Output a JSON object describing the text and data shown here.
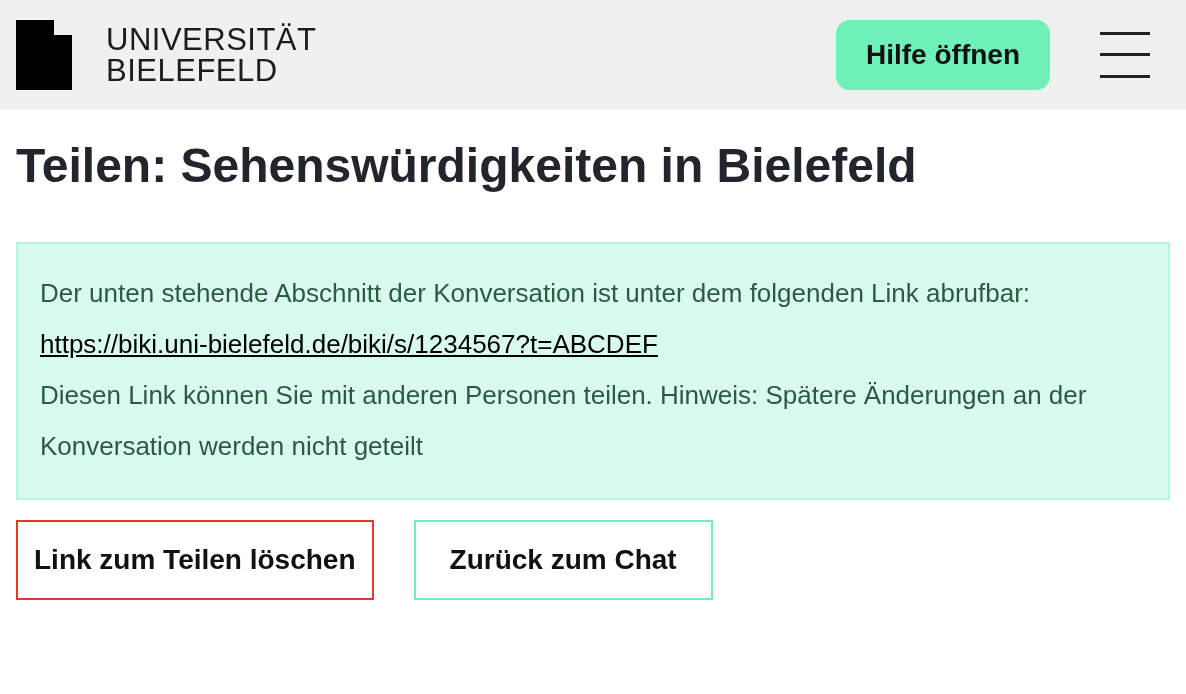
{
  "header": {
    "logo": {
      "line_1": "UNIVERSITÄT",
      "line_2": "BIELEFELD"
    },
    "help_button": "Hilfe öffnen"
  },
  "title": "Teilen: Sehenswürdigkeiten in Bielefeld",
  "info_box": {
    "intro": "Der unten stehende Abschnitt der Konversation ist unter dem folgenden Link abrufbar:",
    "link": "https://biki.uni-bielefeld.de/biki/s/1234567?t=ABCDEF",
    "note": "Diesen Link können Sie mit anderen Personen teilen. Hinweis: Spätere Änderungen an der Konversation werden nicht geteilt"
  },
  "buttons": [
    {
      "label": "Link zum Teilen löschen",
      "kind": "danger"
    },
    {
      "label": "Zurück zum Chat",
      "kind": "secondary"
    }
  ]
}
